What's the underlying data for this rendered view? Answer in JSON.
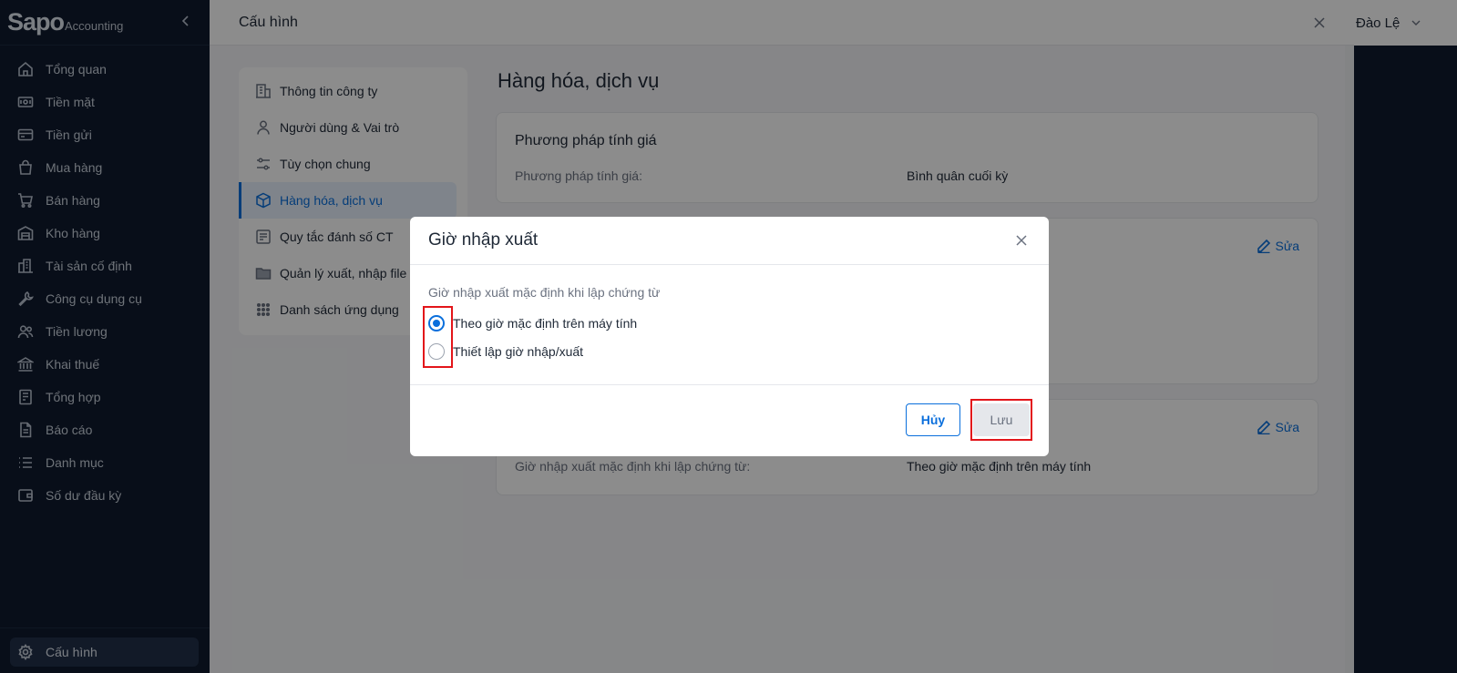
{
  "brand": {
    "logo": "Sapo",
    "sub": "Accounting"
  },
  "sidebar": {
    "items": [
      {
        "label": "Tổng quan",
        "icon": "home-icon"
      },
      {
        "label": "Tiền mặt",
        "icon": "cash-icon"
      },
      {
        "label": "Tiền gửi",
        "icon": "card-icon"
      },
      {
        "label": "Mua hàng",
        "icon": "bag-icon"
      },
      {
        "label": "Bán hàng",
        "icon": "cart-icon"
      },
      {
        "label": "Kho hàng",
        "icon": "warehouse-icon"
      },
      {
        "label": "Tài sản cố định",
        "icon": "buildings-icon"
      },
      {
        "label": "Công cụ dụng cụ",
        "icon": "wrench-icon"
      },
      {
        "label": "Tiền lương",
        "icon": "users-icon"
      },
      {
        "label": "Khai thuế",
        "icon": "bank-icon"
      },
      {
        "label": "Tổng hợp",
        "icon": "ledger-icon"
      },
      {
        "label": "Báo cáo",
        "icon": "report-icon"
      },
      {
        "label": "Danh mục",
        "icon": "list-icon"
      },
      {
        "label": "Số dư đầu kỳ",
        "icon": "wallet-icon"
      }
    ],
    "settings_label": "Cấu hình"
  },
  "user": {
    "name": "Đào Lệ"
  },
  "config": {
    "header_title": "Cấu hình",
    "menu": [
      {
        "label": "Thông tin công ty",
        "icon": "building-icon"
      },
      {
        "label": "Người dùng & Vai trò",
        "icon": "user-icon"
      },
      {
        "label": "Tùy chọn chung",
        "icon": "sliders-icon"
      },
      {
        "label": "Hàng hóa, dịch vụ",
        "icon": "box-icon"
      },
      {
        "label": "Quy tắc đánh số CT",
        "icon": "numbering-icon"
      },
      {
        "label": "Quản lý xuất, nhập file",
        "icon": "folder-icon"
      },
      {
        "label": "Danh sách ứng dụng",
        "icon": "grid-icon"
      }
    ],
    "active_menu_index": 3,
    "section_title": "Hàng hóa, dịch vụ",
    "card1": {
      "title": "Phương pháp tính giá",
      "label": "Phương pháp tính giá:",
      "value": "Bình quân cuối kỳ"
    },
    "card2": {
      "edit_label": "Sửa"
    },
    "card3": {
      "edit_label": "Sửa",
      "label": "Giờ nhập xuất mặc định khi lập chứng từ:",
      "value": "Theo giờ mặc định trên máy tính"
    }
  },
  "modal": {
    "title": "Giờ nhập xuất",
    "description": "Giờ nhập xuất mặc định khi lập chứng từ",
    "options": [
      {
        "label": "Theo giờ mặc định trên máy tính",
        "checked": true
      },
      {
        "label": "Thiết lập giờ nhập/xuất",
        "checked": false
      }
    ],
    "cancel_label": "Hủy",
    "save_label": "Lưu"
  },
  "colors": {
    "primary": "#0a6fdc",
    "sidebar_bg": "#0f1a2e",
    "highlight": "#e3151a"
  }
}
